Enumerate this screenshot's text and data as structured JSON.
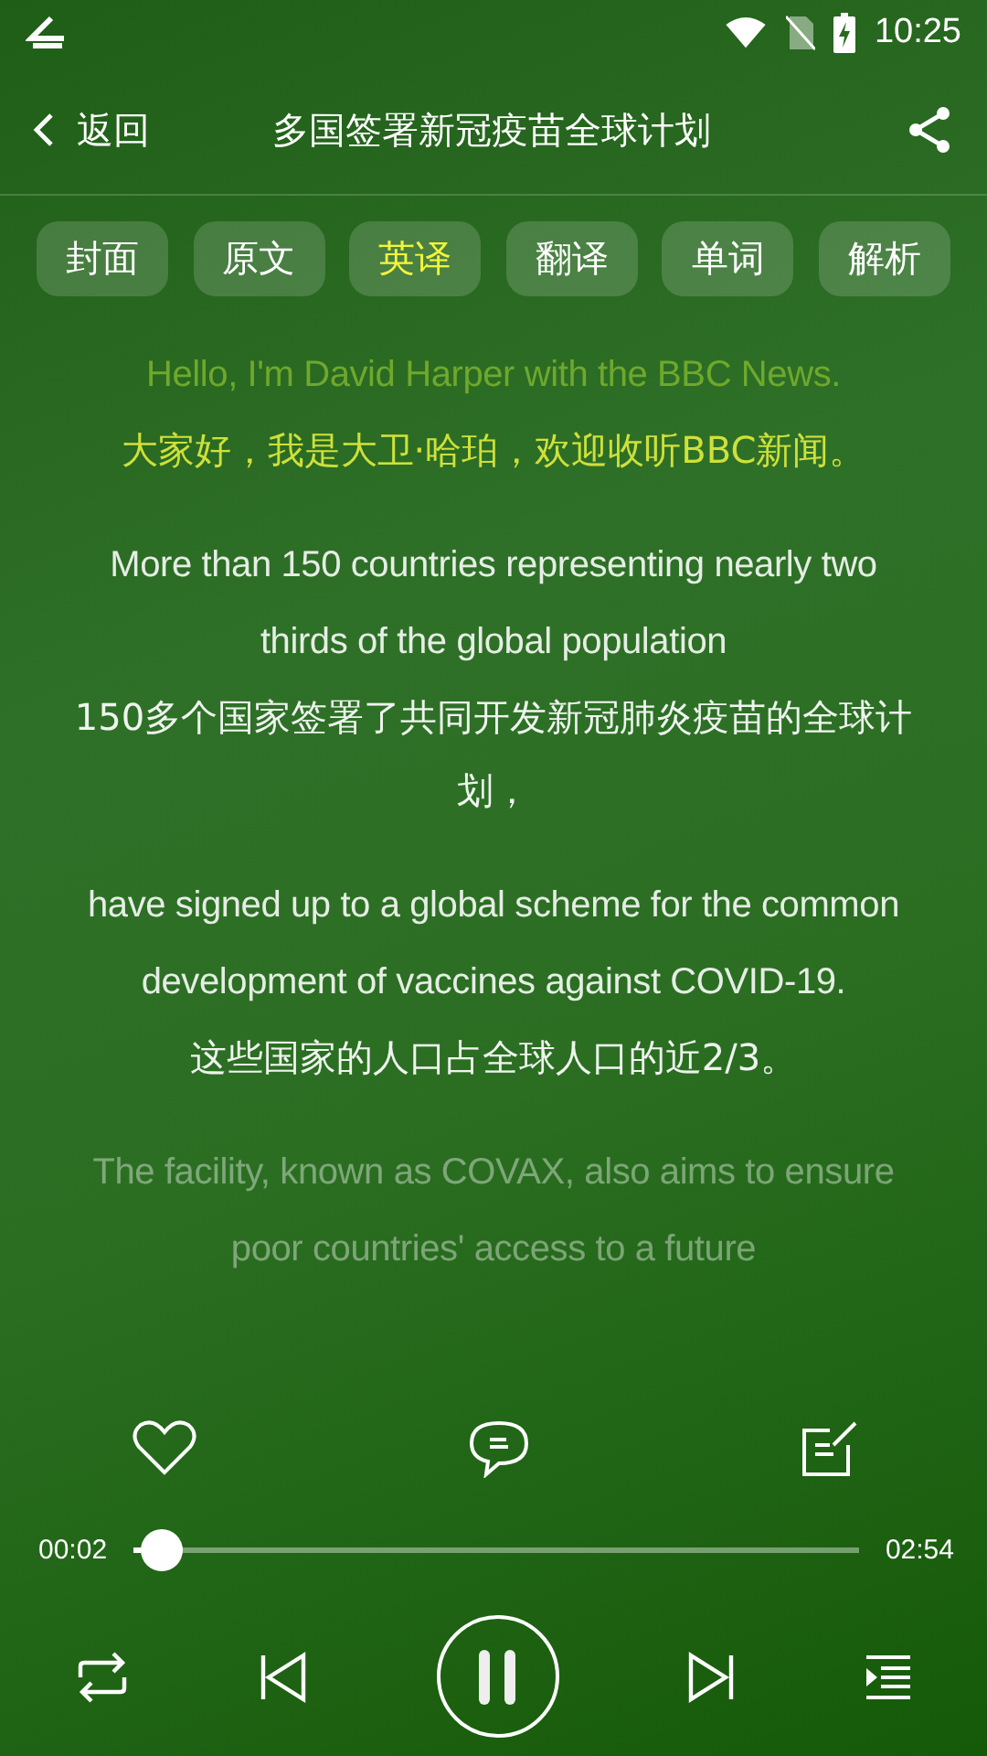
{
  "status_bar": {
    "time": "10:25"
  },
  "header": {
    "back_label": "返回",
    "title": "多国签署新冠疫苗全球计划"
  },
  "tabs": [
    {
      "label": "封面",
      "selected": false
    },
    {
      "label": "原文",
      "selected": false
    },
    {
      "label": "英译",
      "selected": true
    },
    {
      "label": "翻译",
      "selected": false
    },
    {
      "label": "单词",
      "selected": false
    },
    {
      "label": "解析",
      "selected": false
    }
  ],
  "paragraphs": [
    {
      "english": "Hello, I'm David Harper with the BBC News.",
      "chinese": "大家好，我是大卫·哈珀，欢迎收听BBC新闻。",
      "current": true,
      "faded": false
    },
    {
      "english": "More than 150 countries representing nearly two thirds of the global population",
      "chinese": "150多个国家签署了共同开发新冠肺炎疫苗的全球计划，",
      "current": false,
      "faded": false
    },
    {
      "english": "have signed up to a global scheme for the common development of vaccines against COVID-19.",
      "chinese": "这些国家的人口占全球人口的近2/3。",
      "current": false,
      "faded": false
    },
    {
      "english": "The facility, known as COVAX, also aims to ensure poor countries' access to a future",
      "current": false,
      "faded": true
    }
  ],
  "player": {
    "elapsed": "00:02",
    "duration": "02:54",
    "level": 0.01,
    "playing": true
  }
}
